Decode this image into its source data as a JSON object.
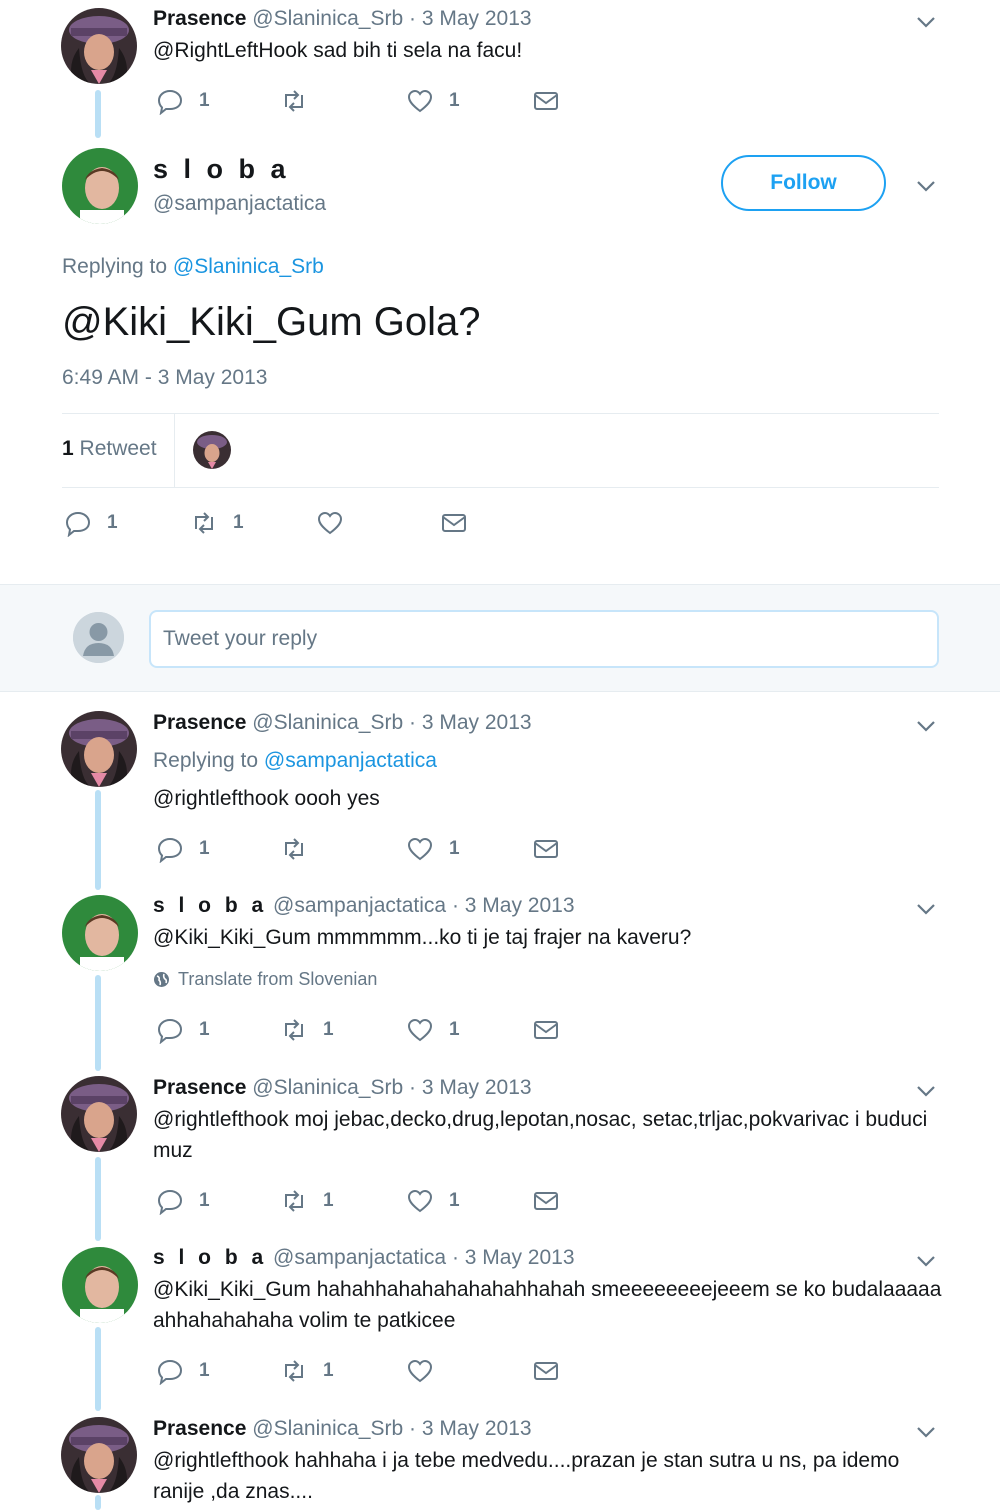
{
  "top_tweet": {
    "name": "Prasence",
    "handle": "@Slaninica_Srb",
    "date": "3 May 2013",
    "text": "@RightLeftHook sad bih ti sela na facu!",
    "replies": "1",
    "retweets": "",
    "likes": "1"
  },
  "main_tweet": {
    "name": "s l o b a",
    "handle": "@sampanjactatica",
    "follow_label": "Follow",
    "replying_to_label": "Replying to",
    "replying_to_handle": "@Slaninica_Srb",
    "text": "@Kiki_Kiki_Gum Gola?",
    "timestamp": "6:49 AM - 3 May 2013",
    "retweet_count": "1",
    "retweet_label": "Retweet",
    "replies": "1",
    "retweets": "1",
    "likes": ""
  },
  "reply_box": {
    "placeholder": "Tweet your reply"
  },
  "thread": [
    {
      "name": "Prasence",
      "handle": "@Slaninica_Srb",
      "date": "3 May 2013",
      "replying_to_label": "Replying to",
      "replying_to_handle": "@sampanjactatica",
      "text": "@rightlefthook oooh yes",
      "replies": "1",
      "retweets": "",
      "likes": "1"
    },
    {
      "name": "s l o b a",
      "handle": "@sampanjactatica",
      "date": "3 May 2013",
      "text": "@Kiki_Kiki_Gum mmmmmm...ko ti je taj frajer na kaveru?",
      "translate_label": "Translate from Slovenian",
      "replies": "1",
      "retweets": "1",
      "likes": "1"
    },
    {
      "name": "Prasence",
      "handle": "@Slaninica_Srb",
      "date": "3 May 2013",
      "text": "@rightlefthook moj jebac,decko,drug,lepotan,nosac, setac,trljac,pokvarivac i buduci muz",
      "replies": "1",
      "retweets": "1",
      "likes": "1"
    },
    {
      "name": "s l o b a",
      "handle": "@sampanjactatica",
      "date": "3 May 2013",
      "text": "@Kiki_Kiki_Gum hahahhahahahahahahhahah smeeeeeeeejeeem se ko budalaaaaa ahhahahahaha volim te patkicee",
      "replies": "1",
      "retweets": "1",
      "likes": ""
    },
    {
      "name": "Prasence",
      "handle": "@Slaninica_Srb",
      "date": "3 May 2013",
      "text": "@rightlefthook hahhaha i ja tebe medvedu....prazan je stan sutra u ns, pa idemo ranije ,da znas...."
    }
  ],
  "date_separator": " · ",
  "timestamp_separator": "",
  "colors": {
    "link": "#1b95e0",
    "thread_line": "#b9dff5",
    "muted": "#657786",
    "follow": "#1da1f2"
  }
}
